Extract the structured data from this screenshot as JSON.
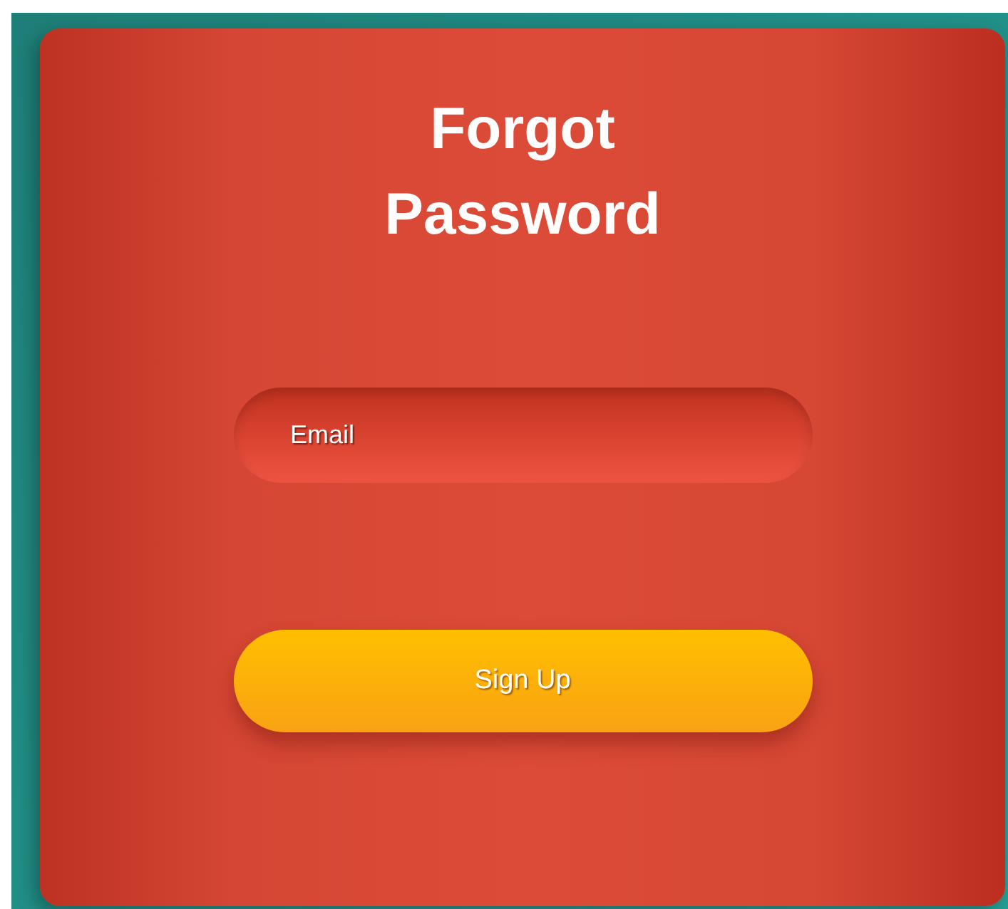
{
  "title": "Forgot Password",
  "email_field": {
    "placeholder": "Email"
  },
  "submit_button": {
    "label": "Sign Up"
  }
}
